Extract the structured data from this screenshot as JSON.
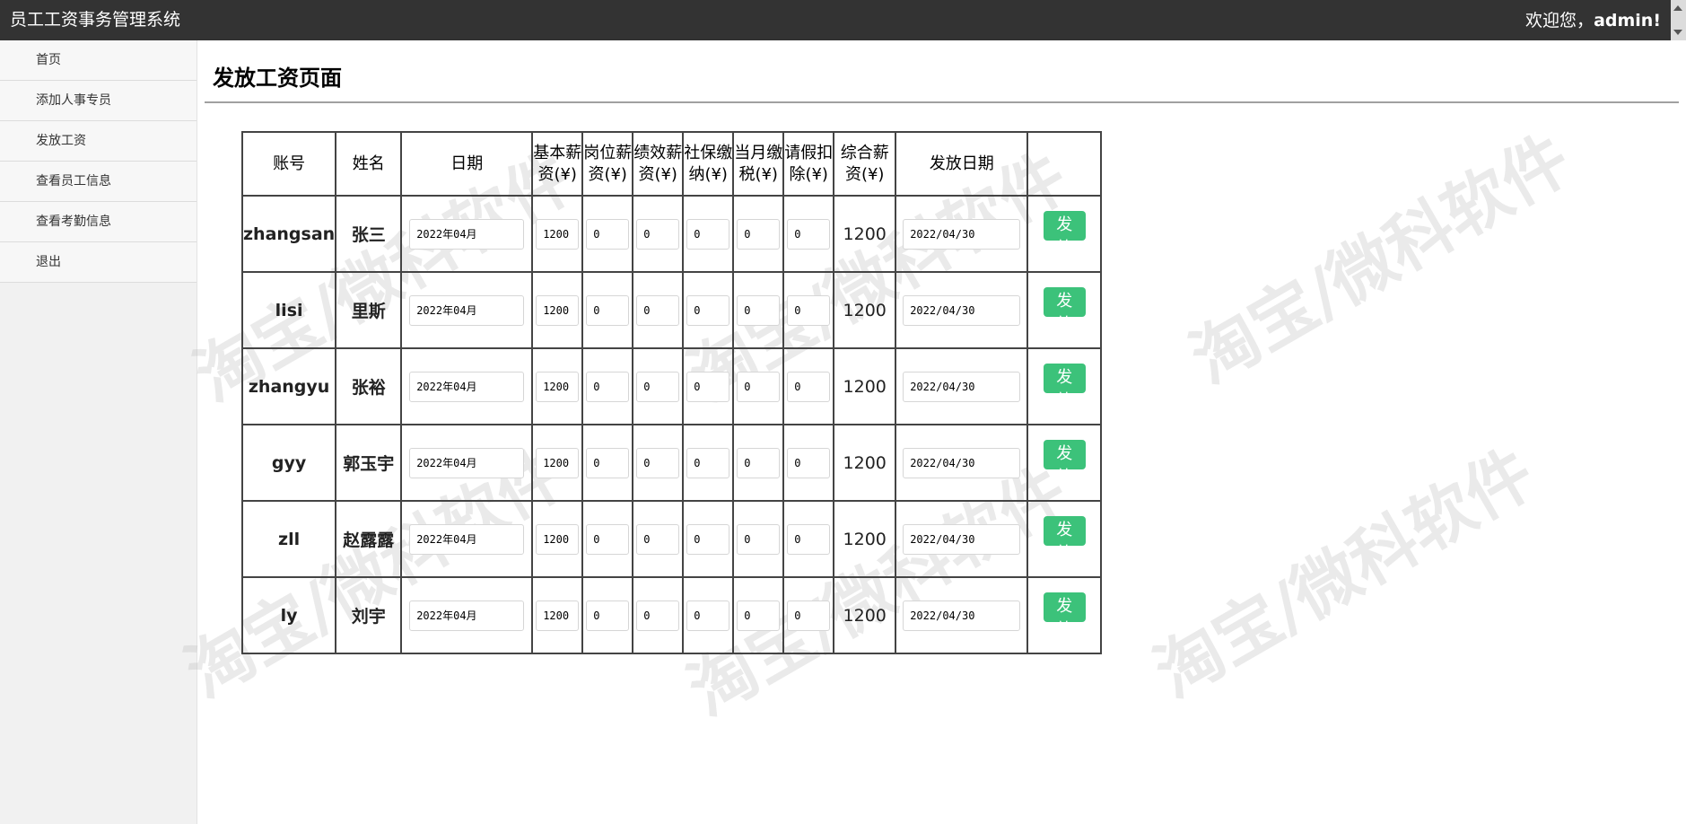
{
  "header": {
    "app_title": "员工工资事务管理系统",
    "welcome_prefix": "欢迎您，",
    "user": "admin!"
  },
  "sidebar": {
    "items": [
      {
        "label": "首页"
      },
      {
        "label": "添加人事专员"
      },
      {
        "label": "发放工资"
      },
      {
        "label": "查看员工信息"
      },
      {
        "label": "查看考勤信息"
      },
      {
        "label": "退出"
      }
    ]
  },
  "page": {
    "title": "发放工资页面",
    "watermark": "淘宝/微科软件"
  },
  "table": {
    "headers": {
      "account": "账号",
      "name": "姓名",
      "date": "日期",
      "base_1": "基本薪",
      "base_2": "资(¥)",
      "post_1": "岗位薪",
      "post_2": "资(¥)",
      "perf_1": "绩效薪",
      "perf_2": "资(¥)",
      "social_1": "社保缴",
      "social_2": "纳(¥)",
      "tax_1": "当月缴",
      "tax_2": "税(¥)",
      "leave_1": "请假扣",
      "leave_2": "除(¥)",
      "total_1": "综合薪",
      "total_2": "资(¥)",
      "paydate": "发放日期",
      "action": ""
    },
    "button_label": "发放",
    "rows": [
      {
        "account": "zhangsan",
        "name": "张三",
        "date": "2022年04月",
        "base": "1200",
        "post": "0",
        "perf": "0",
        "social": "0",
        "tax": "0",
        "leave": "0",
        "total": "1200",
        "paydate": "2022/04/30"
      },
      {
        "account": "lisi",
        "name": "里斯",
        "date": "2022年04月",
        "base": "1200",
        "post": "0",
        "perf": "0",
        "social": "0",
        "tax": "0",
        "leave": "0",
        "total": "1200",
        "paydate": "2022/04/30"
      },
      {
        "account": "zhangyu",
        "name": "张裕",
        "date": "2022年04月",
        "base": "1200",
        "post": "0",
        "perf": "0",
        "social": "0",
        "tax": "0",
        "leave": "0",
        "total": "1200",
        "paydate": "2022/04/30"
      },
      {
        "account": "gyy",
        "name": "郭玉宇",
        "date": "2022年04月",
        "base": "1200",
        "post": "0",
        "perf": "0",
        "social": "0",
        "tax": "0",
        "leave": "0",
        "total": "1200",
        "paydate": "2022/04/30"
      },
      {
        "account": "zll",
        "name": "赵露露",
        "date": "2022年04月",
        "base": "1200",
        "post": "0",
        "perf": "0",
        "social": "0",
        "tax": "0",
        "leave": "0",
        "total": "1200",
        "paydate": "2022/04/30"
      },
      {
        "account": "ly",
        "name": "刘宇",
        "date": "2022年04月",
        "base": "1200",
        "post": "0",
        "perf": "0",
        "social": "0",
        "tax": "0",
        "leave": "0",
        "total": "1200",
        "paydate": "2022/04/30"
      }
    ]
  }
}
